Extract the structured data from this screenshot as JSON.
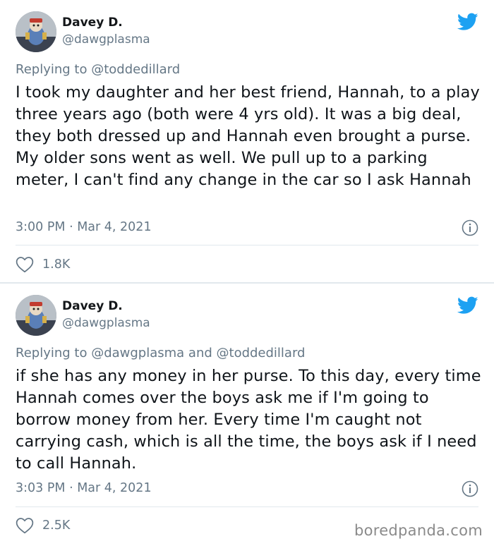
{
  "tweets": [
    {
      "name": "Davey D.",
      "handle": "@dawgplasma",
      "replying_to": "Replying to @toddedillard",
      "text": "I took my daughter and her best friend, Hannah, to a play three years ago (both were 4 yrs old). It was a big deal, they both dressed up and Hannah even brought a purse. My older sons went as well. We pull up to a parking meter, I can't find any change in the car so I ask Hannah",
      "timestamp": "3:00 PM · Mar 4, 2021",
      "likes": "1.8K"
    },
    {
      "name": "Davey D.",
      "handle": "@dawgplasma",
      "replying_to": "Replying to @dawgplasma and @toddedillard",
      "text": "if she has any money in her purse. To this day, every time Hannah comes over the boys ask me if I'm going to borrow money from her. Every time I'm caught not carrying cash, which is all the time, the boys ask if I need to call Hannah.",
      "timestamp": "3:03 PM · Mar 4, 2021",
      "likes": "2.5K"
    }
  ],
  "watermark": "boredpanda.com",
  "icons": {
    "brand": "twitter-bird-icon",
    "info": "info-icon",
    "like": "heart-icon"
  },
  "colors": {
    "twitter_blue": "#1da1f2",
    "secondary_text": "#657786",
    "primary_text": "#0f1419",
    "divider": "#e1e8ed"
  }
}
